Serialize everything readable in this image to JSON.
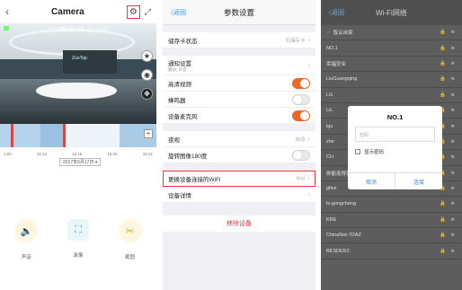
{
  "camera": {
    "title": "Camera",
    "back": "‹",
    "timestamp": "2017年6月17日  16:15:53",
    "video_logo": "ZuoTop",
    "ticks": [
      "1:00",
      "16:13",
      "16:15",
      "16:20",
      "16:21"
    ],
    "date_label": "2017年6月17日 ▾",
    "controls": [
      {
        "label": "声音",
        "icon": "speaker-icon"
      },
      {
        "label": "录像",
        "icon": "record-icon"
      },
      {
        "label": "截图",
        "icon": "screenshot-icon"
      }
    ],
    "timeline_colors": [
      "#b5d3ea",
      "#d24b4b",
      "#b5d3ea",
      "#9cc2e3",
      "#d24b4b",
      "#eef3f7",
      "#a9cbe6"
    ]
  },
  "settings": {
    "back": "〈返回",
    "title": "参数设置",
    "rows_group1": [
      {
        "label": "储存卡状态",
        "value": "无储存卡",
        "type": "link"
      }
    ],
    "rows_group2": [
      {
        "label": "通知设置",
        "sub": "震动, 声音",
        "value": "",
        "type": "link"
      },
      {
        "label": "高清视频",
        "type": "toggle",
        "on": true
      },
      {
        "label": "蜂鸣器",
        "type": "toggle",
        "on": false
      },
      {
        "label": "设备麦克风",
        "type": "toggle",
        "on": true
      }
    ],
    "rows_group3": [
      {
        "label": "夜视",
        "value": "自动",
        "type": "link"
      },
      {
        "label": "旋转图像180度",
        "type": "toggle",
        "on": false
      }
    ],
    "rows_group4": [
      {
        "label": "更换设备连接的WiFi",
        "value": "liuyi",
        "type": "link",
        "highlight": true
      },
      {
        "label": "设备详情",
        "value": "",
        "type": "link"
      }
    ],
    "remove": "移除设备"
  },
  "wifi": {
    "back": "〈返回",
    "title": "Wi-Fi网络",
    "networks": [
      "智云自家",
      "NO.1",
      "幸福安业",
      "LiuGuangqing",
      "LG",
      "LiL",
      "lgu",
      "zhe",
      "CH",
      "你能连得到吗",
      "gfive",
      "ls-gongcheng",
      "KRE",
      "ChinaNet-7DAZ",
      "BESDER2"
    ],
    "dialog": {
      "title": "NO.1",
      "placeholder": "密码",
      "show_password": "显示密码",
      "cancel": "取消",
      "connect": "连接"
    },
    "lock_icon": "🔒 ≋"
  },
  "colors": {
    "accent": "#f26522",
    "highlight": "#e23a3a",
    "link": "#3a8ee6"
  }
}
